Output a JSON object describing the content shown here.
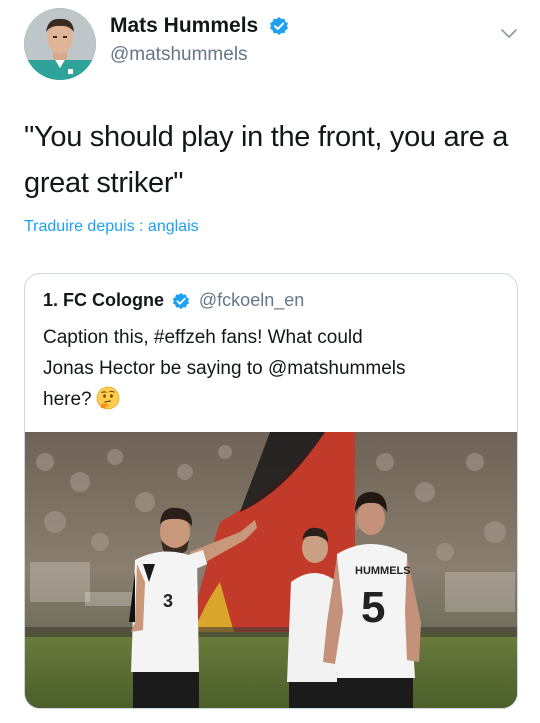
{
  "author": {
    "display_name": "Mats Hummels",
    "handle": "@matshummels",
    "verified": true
  },
  "tweet": {
    "text_line1": "\"You should play in the front, you are a",
    "text_line2": "great striker\"",
    "translate_label": "Traduire depuis : anglais"
  },
  "quoted": {
    "display_name": "1. FC Cologne",
    "handle": "@fckoeln_en",
    "verified": true,
    "text_line1": "Caption this, #effzeh fans! What could",
    "text_line2": "Jonas Hector be saying to @matshummels",
    "text_line3": "here?",
    "emoji": "thinking-face-emoji",
    "photo": {
      "jersey_back_name": "HUMMELS",
      "jersey_number_back": "5",
      "jersey_number_front": "3"
    }
  },
  "colors": {
    "link_blue": "#1da1f2",
    "text_primary": "#14171a",
    "text_secondary": "#657786",
    "border": "#ccd6dd"
  },
  "icons": {
    "verified": "verified-badge-icon",
    "menu": "chevron-down-icon"
  }
}
